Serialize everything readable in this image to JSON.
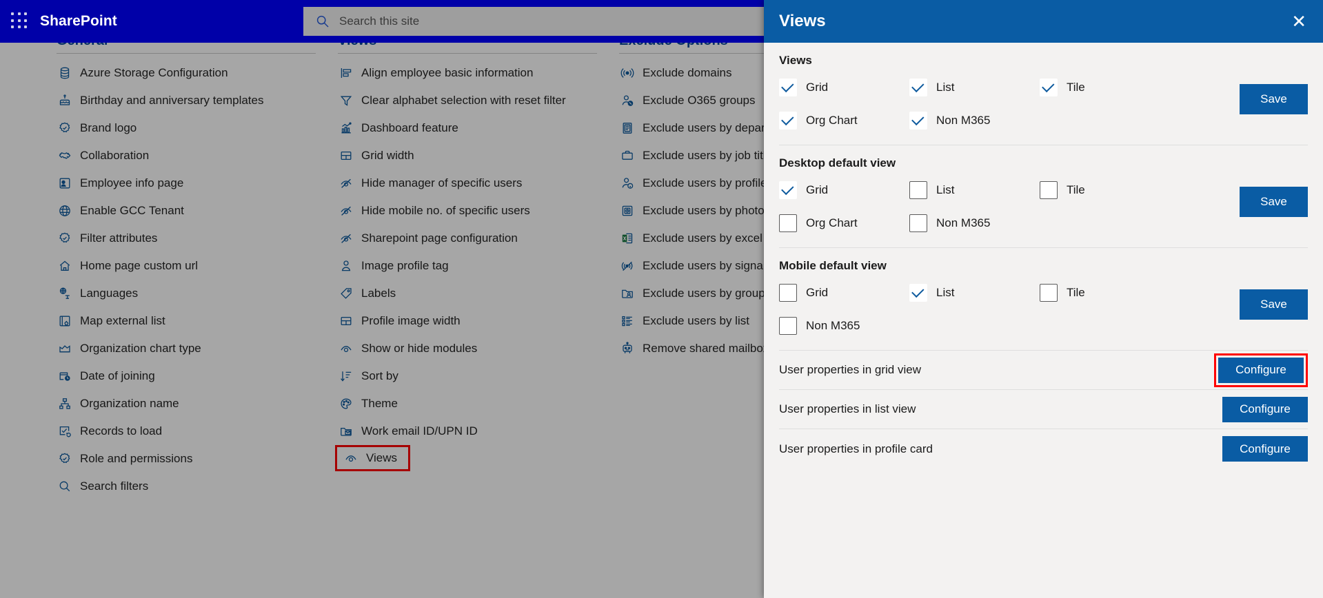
{
  "suitebar": {
    "waffle_icon": "app-launcher-icon",
    "brand": "SharePoint",
    "search": {
      "icon": "search-icon",
      "placeholder": "Search this site",
      "value": ""
    }
  },
  "columns": [
    {
      "heading": "General",
      "items": [
        {
          "label": "Azure Storage Configuration",
          "icon": "database-icon"
        },
        {
          "label": "Birthday and anniversary templates",
          "icon": "cake-icon"
        },
        {
          "label": "Brand logo",
          "icon": "badge-icon"
        },
        {
          "label": "Collaboration",
          "icon": "handshake-icon"
        },
        {
          "label": "Employee info page",
          "icon": "contact-card-icon"
        },
        {
          "label": "Enable GCC Tenant",
          "icon": "globe-icon"
        },
        {
          "label": "Filter attributes",
          "icon": "badge-icon"
        },
        {
          "label": "Home page custom url",
          "icon": "home-icon"
        },
        {
          "label": "Languages",
          "icon": "translate-icon"
        },
        {
          "label": "Map external list",
          "icon": "map-list-icon"
        },
        {
          "label": "Organization chart type",
          "icon": "area-chart-icon"
        },
        {
          "label": "Date of joining",
          "icon": "calendar-clock-icon"
        },
        {
          "label": "Organization name",
          "icon": "org-hierarchy-icon"
        },
        {
          "label": "Records to load",
          "icon": "checkbox-refresh-icon"
        },
        {
          "label": "Role and permissions",
          "icon": "badge-icon"
        },
        {
          "label": "Search filters",
          "icon": "search-icon"
        }
      ]
    },
    {
      "heading": "Views",
      "items": [
        {
          "label": "Align employee basic information",
          "icon": "align-left-icon"
        },
        {
          "label": "Clear alphabet selection with reset filter",
          "icon": "filter-icon"
        },
        {
          "label": "Dashboard feature",
          "icon": "bar-chart-icon"
        },
        {
          "label": "Grid width",
          "icon": "grid-layout-icon"
        },
        {
          "label": "Hide manager of specific users",
          "icon": "eye-hide-icon"
        },
        {
          "label": "Hide mobile no. of specific users",
          "icon": "eye-hide-icon"
        },
        {
          "label": "Sharepoint page configuration",
          "icon": "eye-hide-icon"
        },
        {
          "label": "Image profile tag",
          "icon": "person-icon"
        },
        {
          "label": "Labels",
          "icon": "tag-icon"
        },
        {
          "label": "Profile image width",
          "icon": "grid-layout-icon"
        },
        {
          "label": "Show or hide modules",
          "icon": "eye-icon"
        },
        {
          "label": "Sort by",
          "icon": "sort-descending-icon"
        },
        {
          "label": "Theme",
          "icon": "palette-icon"
        },
        {
          "label": "Work email ID/UPN ID",
          "icon": "mail-folder-icon"
        },
        {
          "label": "Views",
          "icon": "eye-icon",
          "selected": true
        }
      ]
    },
    {
      "heading": "Exclude Options",
      "items": [
        {
          "label": "Exclude domains",
          "icon": "broadcast-icon"
        },
        {
          "label": "Exclude O365 groups",
          "icon": "person-block-icon"
        },
        {
          "label": "Exclude users by department",
          "icon": "document-list-icon"
        },
        {
          "label": "Exclude users by job title",
          "icon": "briefcase-icon"
        },
        {
          "label": "Exclude users by profile",
          "icon": "person-info-icon"
        },
        {
          "label": "Exclude users by photo",
          "icon": "photo-box-icon"
        },
        {
          "label": "Exclude users by excel",
          "icon": "excel-icon"
        },
        {
          "label": "Exclude users by signal",
          "icon": "broadcast-block-icon"
        },
        {
          "label": "Exclude users by group",
          "icon": "folder-person-icon"
        },
        {
          "label": "Exclude users by list",
          "icon": "bullet-list-icon"
        },
        {
          "label": "Remove shared mailbox",
          "icon": "robot-icon"
        }
      ]
    }
  ],
  "panel": {
    "title": "Views",
    "close_icon": "close-icon",
    "sections": [
      {
        "title": "Views",
        "save_label": "Save",
        "rows": [
          [
            {
              "label": "Grid",
              "checked": true
            },
            {
              "label": "List",
              "checked": true
            },
            {
              "label": "Tile",
              "checked": true
            }
          ],
          [
            {
              "label": "Org Chart",
              "checked": true
            },
            {
              "label": "Non M365",
              "checked": true
            }
          ]
        ]
      },
      {
        "title": "Desktop default view",
        "save_label": "Save",
        "rows": [
          [
            {
              "label": "Grid",
              "checked": true
            },
            {
              "label": "List",
              "checked": false
            },
            {
              "label": "Tile",
              "checked": false
            }
          ],
          [
            {
              "label": "Org Chart",
              "checked": false
            },
            {
              "label": "Non M365",
              "checked": false
            }
          ]
        ]
      },
      {
        "title": "Mobile default view",
        "save_label": "Save",
        "rows": [
          [
            {
              "label": "Grid",
              "checked": false
            },
            {
              "label": "List",
              "checked": true
            },
            {
              "label": "Tile",
              "checked": false
            }
          ],
          [
            {
              "label": "Non M365",
              "checked": false
            }
          ]
        ]
      }
    ],
    "property_rows": [
      {
        "label": "User properties in grid view",
        "button": "Configure",
        "highlighted": true
      },
      {
        "label": "User properties in list view",
        "button": "Configure",
        "highlighted": false
      },
      {
        "label": "User properties in profile card",
        "button": "Configure",
        "highlighted": false
      }
    ]
  },
  "colors": {
    "suitebar_bg": "#0000a8",
    "panel_header_bg": "#0a5ca4",
    "panel_bg": "#f3f2f1",
    "accent_button": "#0a5ca4",
    "highlight_outline": "#ff0000",
    "icon_blue": "#0f5b9e",
    "heading_blue": "#0b4a9c"
  }
}
